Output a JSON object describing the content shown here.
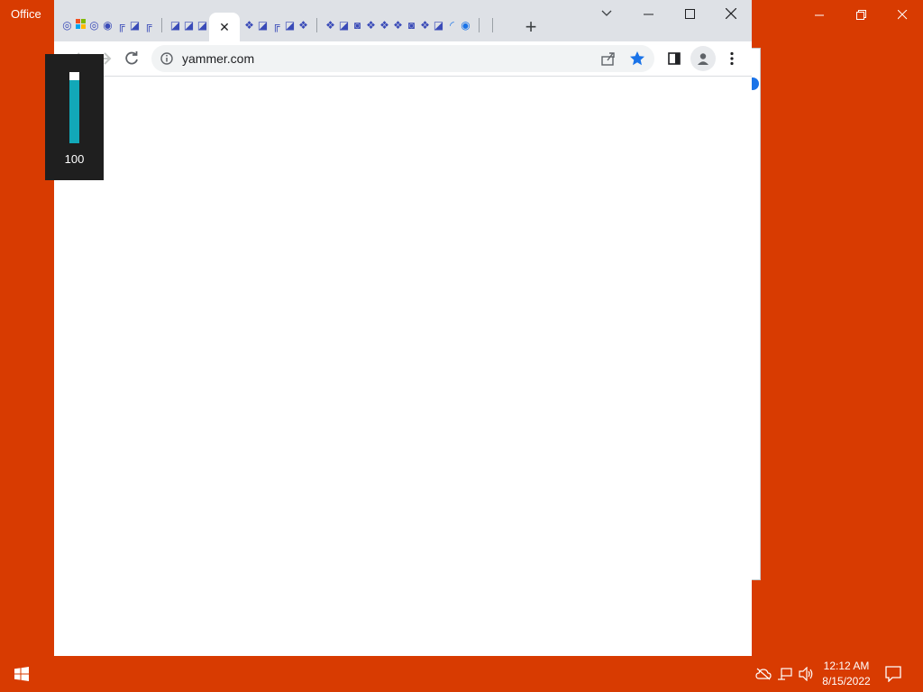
{
  "desktop": {
    "title": "Office"
  },
  "browser": {
    "tab_strip_favicons": [
      "globe-icon",
      "ms-logo-icon",
      "globe-icon",
      "globe-icon",
      "notebook-icon",
      "outlook-icon",
      "notebook-icon",
      "separator",
      "outlook-icon",
      "outlook-icon",
      "outlook-icon"
    ],
    "tab_strip_favicons_after": [
      "teams-icon",
      "outlook-icon",
      "notebook-icon",
      "outlook-icon",
      "teams-icon",
      "separator",
      "teams-icon",
      "outlook-icon",
      "sharepoint-icon",
      "teams-icon",
      "teams-icon",
      "teams-icon",
      "sharepoint-icon",
      "teams-icon",
      "outlook-icon",
      "loading-icon",
      "globe-icon",
      "separator",
      "blank-icon"
    ],
    "active_tab_close": "✕",
    "new_tab_label": "+",
    "address": {
      "url": "yammer.com"
    },
    "bookmark_color": "#1a73e8"
  },
  "zoom": {
    "value": "100",
    "level_percent": 88
  },
  "taskbar": {
    "time": "12:12 AM",
    "date": "8/15/2022"
  },
  "colors": {
    "desktop": "#d83b01",
    "accent": "#12a8b8"
  }
}
